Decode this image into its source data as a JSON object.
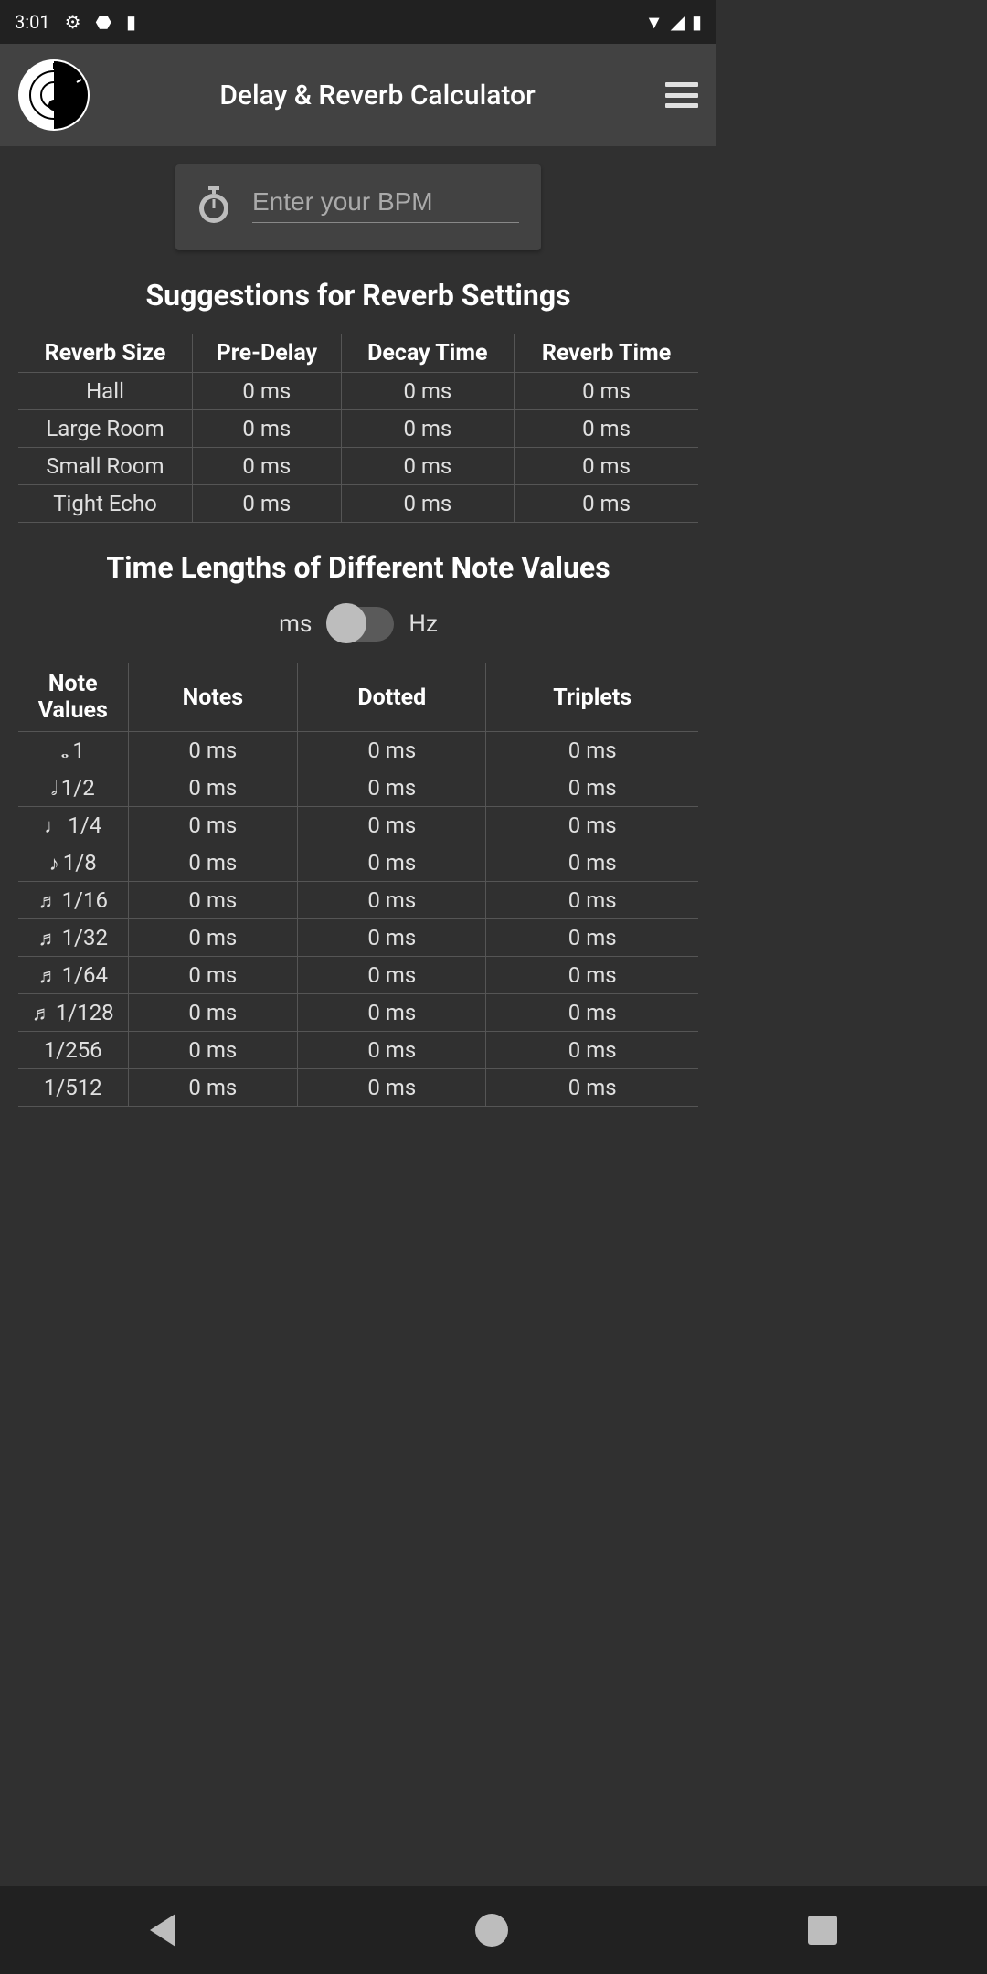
{
  "status": {
    "time": "3:01"
  },
  "header": {
    "title": "Delay & Reverb Calculator"
  },
  "bpm": {
    "placeholder": "Enter your BPM",
    "value": ""
  },
  "section1": {
    "title": "Suggestions for Reverb Settings"
  },
  "reverb_table": {
    "headers": [
      "Reverb Size",
      "Pre-Delay",
      "Decay Time",
      "Reverb Time"
    ],
    "rows": [
      {
        "size": "Hall",
        "predelay": "0 ms",
        "decay": "0 ms",
        "reverb": "0 ms"
      },
      {
        "size": "Large Room",
        "predelay": "0 ms",
        "decay": "0 ms",
        "reverb": "0 ms"
      },
      {
        "size": "Small Room",
        "predelay": "0 ms",
        "decay": "0 ms",
        "reverb": "0 ms"
      },
      {
        "size": "Tight Echo",
        "predelay": "0 ms",
        "decay": "0 ms",
        "reverb": "0 ms"
      }
    ]
  },
  "section2": {
    "title": "Time Lengths of Different Note Values"
  },
  "unit": {
    "left": "ms",
    "right": "Hz"
  },
  "notes_table": {
    "headers": [
      "Note Values",
      "Notes",
      "Dotted",
      "Triplets"
    ],
    "rows": [
      {
        "glyph": "𝅝",
        "label": "1",
        "notes": "0 ms",
        "dotted": "0 ms",
        "triplets": "0 ms"
      },
      {
        "glyph": "𝅗𝅥",
        "label": "1/2",
        "notes": "0 ms",
        "dotted": "0 ms",
        "triplets": "0 ms"
      },
      {
        "glyph": "♩",
        "label": "1/4",
        "notes": "0 ms",
        "dotted": "0 ms",
        "triplets": "0 ms"
      },
      {
        "glyph": "♪",
        "label": "1/8",
        "notes": "0 ms",
        "dotted": "0 ms",
        "triplets": "0 ms"
      },
      {
        "glyph": "♬",
        "label": "1/16",
        "notes": "0 ms",
        "dotted": "0 ms",
        "triplets": "0 ms"
      },
      {
        "glyph": "♬",
        "label": "1/32",
        "notes": "0 ms",
        "dotted": "0 ms",
        "triplets": "0 ms"
      },
      {
        "glyph": "♬",
        "label": "1/64",
        "notes": "0 ms",
        "dotted": "0 ms",
        "triplets": "0 ms"
      },
      {
        "glyph": "♬",
        "label": "1/128",
        "notes": "0 ms",
        "dotted": "0 ms",
        "triplets": "0 ms"
      },
      {
        "glyph": "",
        "label": "1/256",
        "notes": "0 ms",
        "dotted": "0 ms",
        "triplets": "0 ms"
      },
      {
        "glyph": "",
        "label": "1/512",
        "notes": "0 ms",
        "dotted": "0 ms",
        "triplets": "0 ms"
      }
    ]
  }
}
